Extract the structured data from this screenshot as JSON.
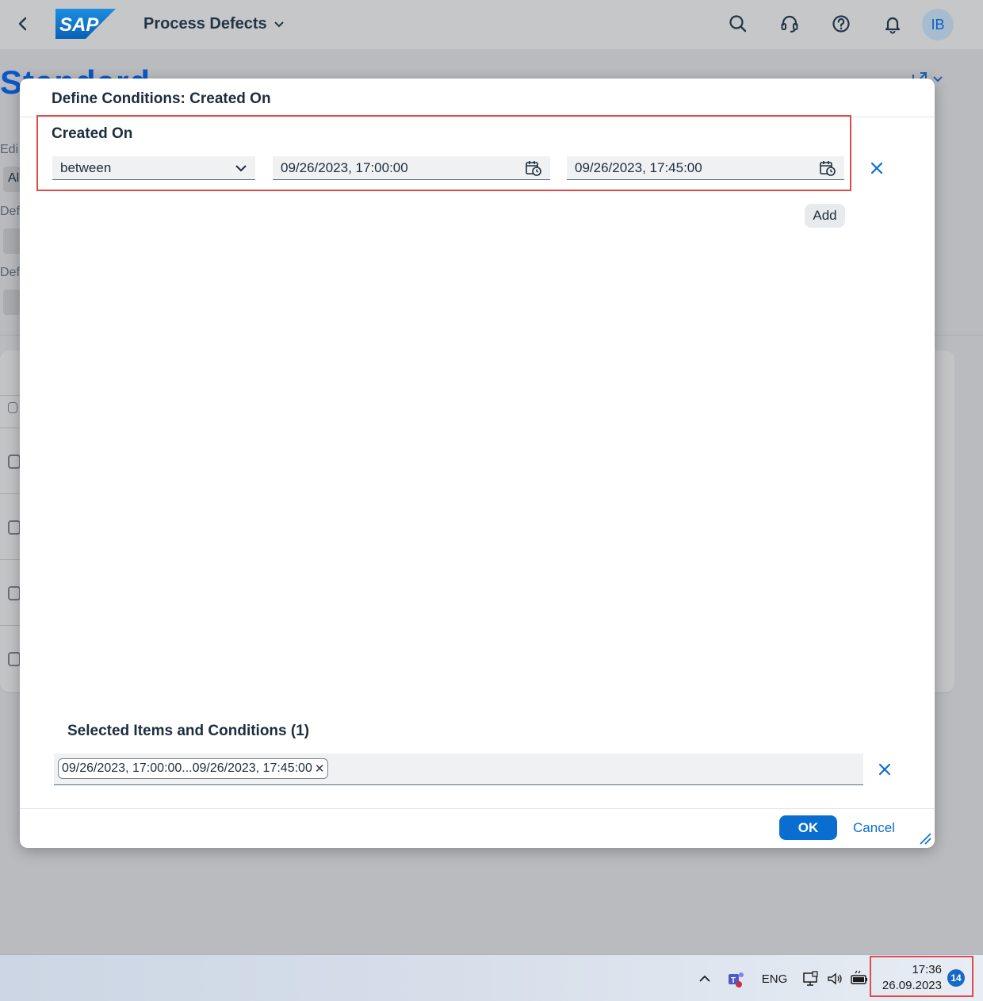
{
  "shell": {
    "logo_text": "SAP",
    "app_title": "Process Defects",
    "avatar_initials": "IB"
  },
  "background": {
    "page_title": "Standard",
    "labels": [
      "Edi",
      "Al",
      "Def",
      "Def"
    ]
  },
  "dialog": {
    "title": "Define Conditions: Created On",
    "condition_title": "Created On",
    "operator": "between",
    "from_value": "09/26/2023, 17:00:00",
    "to_value": "09/26/2023, 17:45:00",
    "add_label": "Add",
    "selected_title": "Selected Items and Conditions (1)",
    "tokens": [
      "09/26/2023, 17:00:00...09/26/2023, 17:45:00"
    ],
    "ok_label": "OK",
    "cancel_label": "Cancel"
  },
  "taskbar": {
    "language": "ENG",
    "time": "17:36",
    "date": "26.09.2023",
    "notification_count": "14"
  },
  "colors": {
    "accent": "#0a6ed1",
    "highlight": "#e04a4a"
  }
}
